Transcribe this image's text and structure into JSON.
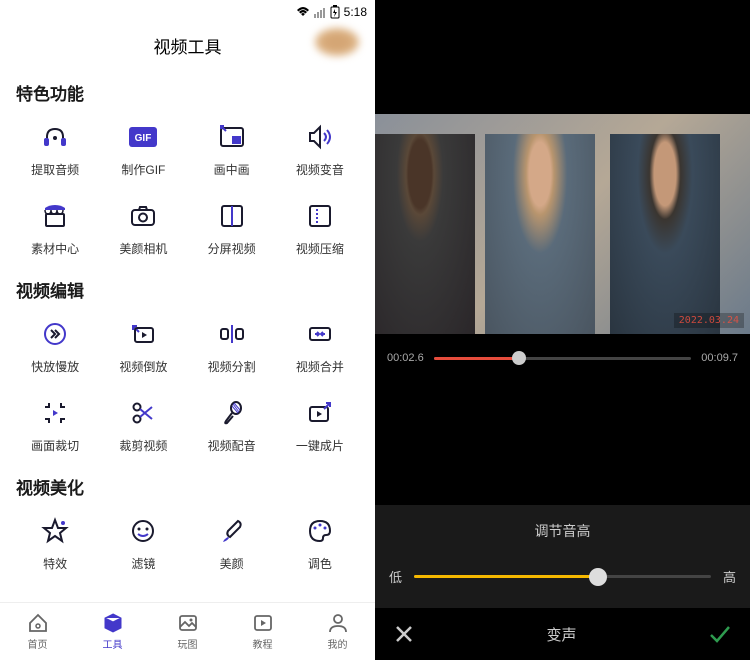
{
  "left": {
    "status_time": "5:18",
    "title": "视频工具",
    "sections": [
      {
        "title": "特色功能",
        "items": [
          {
            "label": "提取音频",
            "icon": "headphones"
          },
          {
            "label": "制作GIF",
            "icon": "gif"
          },
          {
            "label": "画中画",
            "icon": "pip"
          },
          {
            "label": "视频变音",
            "icon": "voice"
          },
          {
            "label": "素材中心",
            "icon": "store"
          },
          {
            "label": "美颜相机",
            "icon": "camera"
          },
          {
            "label": "分屏视频",
            "icon": "split"
          },
          {
            "label": "视频压缩",
            "icon": "compress"
          }
        ]
      },
      {
        "title": "视频编辑",
        "items": [
          {
            "label": "快放慢放",
            "icon": "speed"
          },
          {
            "label": "视频倒放",
            "icon": "reverse"
          },
          {
            "label": "视频分割",
            "icon": "cut"
          },
          {
            "label": "视频合并",
            "icon": "merge"
          },
          {
            "label": "画面裁切",
            "icon": "crop"
          },
          {
            "label": "裁剪视频",
            "icon": "scissors"
          },
          {
            "label": "视频配音",
            "icon": "mic"
          },
          {
            "label": "一键成片",
            "icon": "onekey"
          }
        ]
      },
      {
        "title": "视频美化",
        "items": [
          {
            "label": "特效",
            "icon": "star"
          },
          {
            "label": "滤镜",
            "icon": "face"
          },
          {
            "label": "美颜",
            "icon": "brush"
          },
          {
            "label": "调色",
            "icon": "palette"
          }
        ]
      }
    ],
    "nav": [
      {
        "label": "首页",
        "icon": "home"
      },
      {
        "label": "工具",
        "icon": "cube",
        "active": true
      },
      {
        "label": "玩图",
        "icon": "image"
      },
      {
        "label": "教程",
        "icon": "play"
      },
      {
        "label": "我的",
        "icon": "user"
      }
    ]
  },
  "right": {
    "watermark": "2022.03.24",
    "timeline": {
      "current": "00:02.6",
      "total": "00:09.7",
      "progress": 33
    },
    "pitch": {
      "title": "调节音高",
      "low": "低",
      "high": "高",
      "value": 62
    },
    "action_label": "变声"
  }
}
